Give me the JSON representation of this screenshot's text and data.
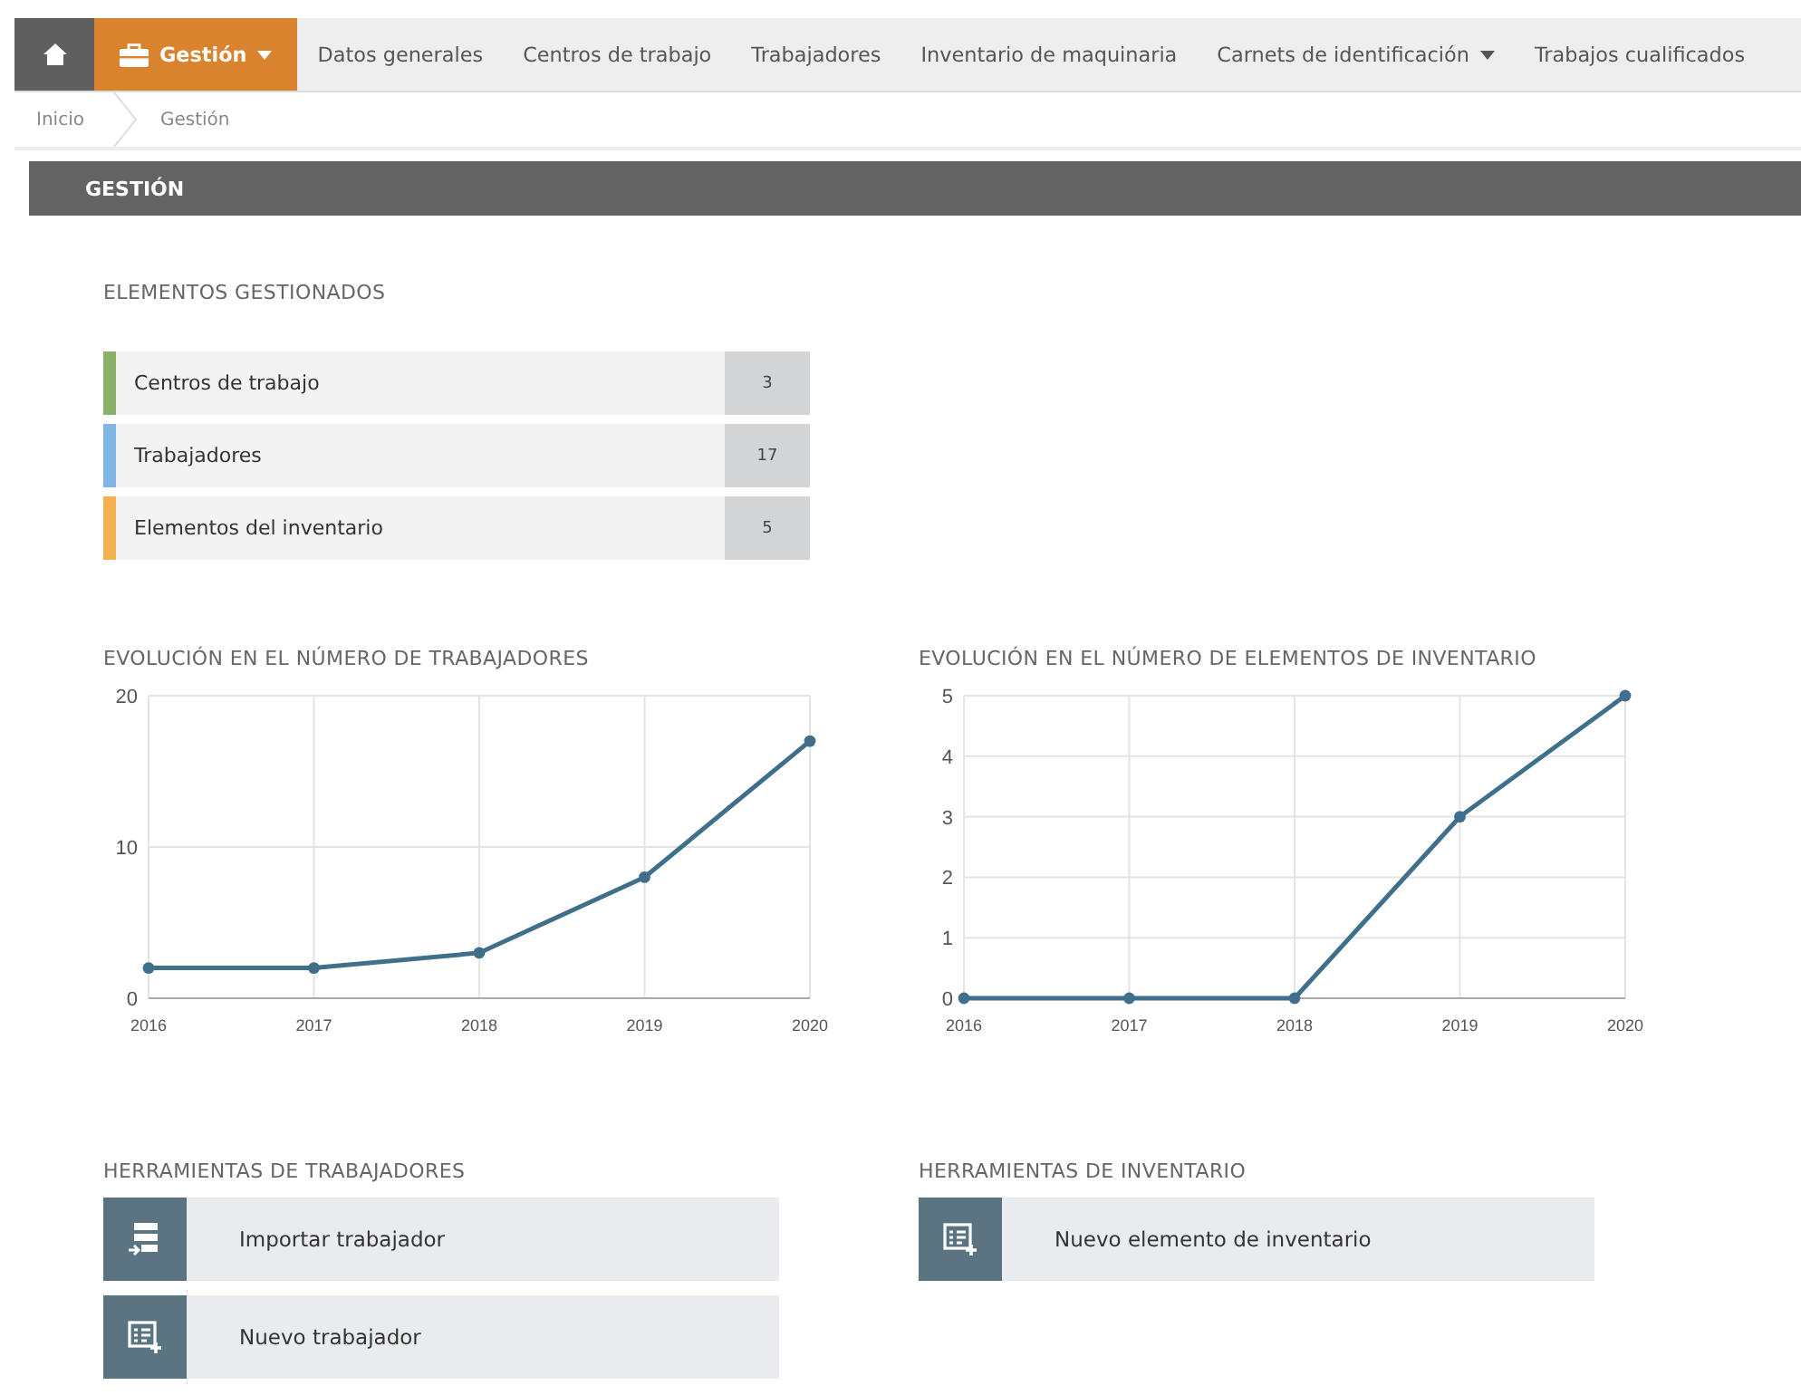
{
  "nav": [
    {
      "kind": "home",
      "selected": false
    },
    {
      "kind": "dropdown",
      "label": "Gestión",
      "selected": true
    },
    {
      "kind": "link",
      "label": "Datos generales",
      "selected": false
    },
    {
      "kind": "link",
      "label": "Centros de trabajo",
      "selected": false
    },
    {
      "kind": "link",
      "label": "Trabajadores",
      "selected": false
    },
    {
      "kind": "link",
      "label": "Inventario de maquinaria",
      "selected": false
    },
    {
      "kind": "dropdown",
      "label": "Carnets de identificación",
      "selected": false
    },
    {
      "kind": "link",
      "label": "Trabajos cualificados",
      "selected": false
    }
  ],
  "breadcrumb": [
    "Inicio",
    "Gestión"
  ],
  "page_title": "GESTIÓN",
  "managed": {
    "title": "ELEMENTOS GESTIONADOS",
    "items": [
      {
        "label": "Centros de trabajo",
        "count": "3",
        "color": "#8bb06a"
      },
      {
        "label": "Trabajadores",
        "count": "17",
        "color": "#7fb6e6"
      },
      {
        "label": "Elementos del inventario",
        "count": "5",
        "color": "#f5b04f"
      }
    ]
  },
  "charts": [
    {
      "title": "EVOLUCIÓN EN EL NÚMERO DE TRABAJADORES",
      "chart_data": {
        "type": "line",
        "categories": [
          "2016",
          "2017",
          "2018",
          "2019",
          "2020"
        ],
        "grid": true,
        "series": [
          {
            "color": "#3f6f8a",
            "marker": true,
            "values": [
              2,
              2,
              3,
              8,
              17
            ]
          }
        ],
        "ylim": [
          0,
          20
        ],
        "yticks": [
          0,
          10,
          20
        ]
      }
    },
    {
      "title": "EVOLUCIÓN EN EL NÚMERO DE ELEMENTOS DE INVENTARIO",
      "chart_data": {
        "type": "line",
        "categories": [
          "2016",
          "2017",
          "2018",
          "2019",
          "2020"
        ],
        "grid": true,
        "series": [
          {
            "color": "#3f6f8a",
            "marker": true,
            "values": [
              0,
              0,
              0,
              3,
              5
            ]
          }
        ],
        "ylim": [
          0,
          5
        ],
        "yticks": [
          0,
          1,
          2,
          3,
          4,
          5
        ]
      }
    }
  ],
  "tools": [
    {
      "title": "HERRAMIENTAS DE TRABAJADORES",
      "buttons": [
        {
          "kind": "import",
          "label": "Importar trabajador"
        },
        {
          "kind": "add",
          "label": "Nuevo trabajador"
        }
      ]
    },
    {
      "title": "HERRAMIENTAS DE INVENTARIO",
      "buttons": [
        {
          "kind": "add",
          "label": "Nuevo elemento de inventario"
        }
      ]
    }
  ]
}
